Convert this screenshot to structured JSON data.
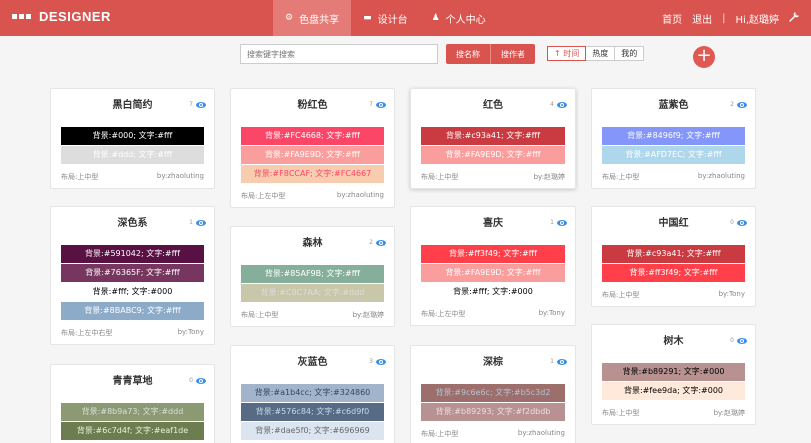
{
  "header": {
    "brand": "DESIGNER",
    "nav": [
      {
        "label": "色盘共享",
        "icon": "palette-icon",
        "glyph": "⚙"
      },
      {
        "label": "设计台",
        "icon": "easel-icon",
        "glyph": "▬"
      },
      {
        "label": "个人中心",
        "icon": "user-icon",
        "glyph": "♟"
      }
    ],
    "links": {
      "home": "首页",
      "logout": "退出",
      "sep": "|",
      "greeting": "Hi,赵璐婷",
      "tool_icon": "wrench-icon"
    }
  },
  "toolbar": {
    "search_placeholder": "搜索键字搜索",
    "search_by_name": "搜名称",
    "search_by_author": "搜作者",
    "sort": [
      "↑ 时间",
      "热度",
      "我的"
    ],
    "add": "+"
  },
  "cards": [
    {
      "title": "黑白简约",
      "views": "7",
      "layout": "布局:上中型",
      "author": "by:zhaoluting",
      "swatches": [
        {
          "text": "背景:#000; 文字:#fff",
          "bg": "#000000",
          "fg": "#ffffff"
        },
        {
          "text": "背景:#ddd; 文字:#fff",
          "bg": "#dddddd",
          "fg": "#ffffff"
        }
      ]
    },
    {
      "title": "深色系",
      "views": "1",
      "layout": "布局:上左中右型",
      "author": "by:Tony",
      "swatches": [
        {
          "text": "背景:#591042; 文字:#fff",
          "bg": "#591042",
          "fg": "#ffffff"
        },
        {
          "text": "背景:#76365F; 文字:#fff",
          "bg": "#76365F",
          "fg": "#ffffff"
        },
        {
          "text": "背景:#fff; 文字:#000",
          "bg": "#ffffff",
          "fg": "#000000"
        },
        {
          "text": "背景:#8BABC9; 文字:#fff",
          "bg": "#8BABC9",
          "fg": "#ffffff"
        }
      ]
    },
    {
      "title": "青青草地",
      "views": "0",
      "layout": "",
      "author": "",
      "swatches": [
        {
          "text": "背景:#8b9a73; 文字:#ddd",
          "bg": "#8b9a73",
          "fg": "#dddddd"
        },
        {
          "text": "背景:#6c7d4f; 文字:#eaf1de",
          "bg": "#6c7d4f",
          "fg": "#eaf1de"
        }
      ]
    },
    {
      "title": "粉红色",
      "views": "7",
      "layout": "布局:上左中型",
      "author": "by:zhaoluting",
      "swatches": [
        {
          "text": "背景:#FC4668; 文字:#fff",
          "bg": "#FC4668",
          "fg": "#ffffff"
        },
        {
          "text": "背景:#FA9E9D; 文字:#fff",
          "bg": "#FA9E9D",
          "fg": "#ffffff"
        },
        {
          "text": "背景:#F8CCAF; 文字:#FC4667",
          "bg": "#F8CCAF",
          "fg": "#FC4667"
        }
      ]
    },
    {
      "title": "森林",
      "views": "2",
      "layout": "布局:上中型",
      "author": "by:赵璐婷",
      "swatches": [
        {
          "text": "背景:#85AF9B; 文字:#fff",
          "bg": "#85AF9B",
          "fg": "#ffffff"
        },
        {
          "text": "背景:#C8C7AA; 文字:#ddd",
          "bg": "#C8C7AA",
          "fg": "#dddddd"
        }
      ]
    },
    {
      "title": "灰蓝色",
      "views": "3",
      "layout": "",
      "author": "",
      "swatches": [
        {
          "text": "背景:#a1b4cc; 文字:#324860",
          "bg": "#a1b4cc",
          "fg": "#324860"
        },
        {
          "text": "背景:#576c84; 文字:#c6d9f0",
          "bg": "#576c84",
          "fg": "#c6d9f0"
        },
        {
          "text": "背景:#dae5f0; 文字:#696969",
          "bg": "#dae5f0",
          "fg": "#696969"
        }
      ]
    },
    {
      "title": "红色",
      "views": "4",
      "layout": "布局:上中型",
      "author": "by:赵璐婷",
      "swatches": [
        {
          "text": "背景:#c93a41; 文字:#fff",
          "bg": "#c93a41",
          "fg": "#ffffff"
        },
        {
          "text": "背景:#FA9E9D; 文字:#fff",
          "bg": "#FA9E9D",
          "fg": "#ffffff"
        }
      ]
    },
    {
      "title": "喜庆",
      "views": "1",
      "layout": "布局:上左中型",
      "author": "by:Tony",
      "swatches": [
        {
          "text": "背景:#ff3f49; 文字:#fff",
          "bg": "#ff3f49",
          "fg": "#ffffff"
        },
        {
          "text": "背景:#FA9E9D; 文字:#fff",
          "bg": "#FA9E9D",
          "fg": "#ffffff"
        },
        {
          "text": "背景:#fff; 文字:#000",
          "bg": "#ffffff",
          "fg": "#000000"
        }
      ]
    },
    {
      "title": "深棕",
      "views": "1",
      "layout": "布局:上中型",
      "author": "by:zhaoluting",
      "swatches": [
        {
          "text": "背景:#9c6e6c; 文字:#b5c3d2",
          "bg": "#9c6e6c",
          "fg": "#b5c3d2"
        },
        {
          "text": "背景:#b89293; 文字:#f2dbdb",
          "bg": "#b89293",
          "fg": "#f2dbdb"
        }
      ]
    },
    {
      "title": "蓝紫色",
      "views": "2",
      "layout": "布局:上中型",
      "author": "by:zhaoluting",
      "swatches": [
        {
          "text": "背景:#8496f9; 文字:#fff",
          "bg": "#8496f9",
          "fg": "#ffffff"
        },
        {
          "text": "背景:#AFD7EC; 文字:#fff",
          "bg": "#AFD7EC",
          "fg": "#ffffff"
        }
      ]
    },
    {
      "title": "中国红",
      "views": "0",
      "layout": "布局:上中型",
      "author": "by:Tony",
      "swatches": [
        {
          "text": "背景:#c93a41; 文字:#fff",
          "bg": "#c93a41",
          "fg": "#ffffff"
        },
        {
          "text": "背景:#ff3f49; 文字:#fff",
          "bg": "#ff3f49",
          "fg": "#ffffff"
        }
      ]
    },
    {
      "title": "树木",
      "views": "0",
      "layout": "布局:上中型",
      "author": "by:赵璐婷",
      "swatches": [
        {
          "text": "背景:#b89291; 文字:#000",
          "bg": "#b89291",
          "fg": "#000000"
        },
        {
          "text": "背景:#fee9da; 文字:#000",
          "bg": "#fee9da",
          "fg": "#000000"
        }
      ]
    }
  ]
}
